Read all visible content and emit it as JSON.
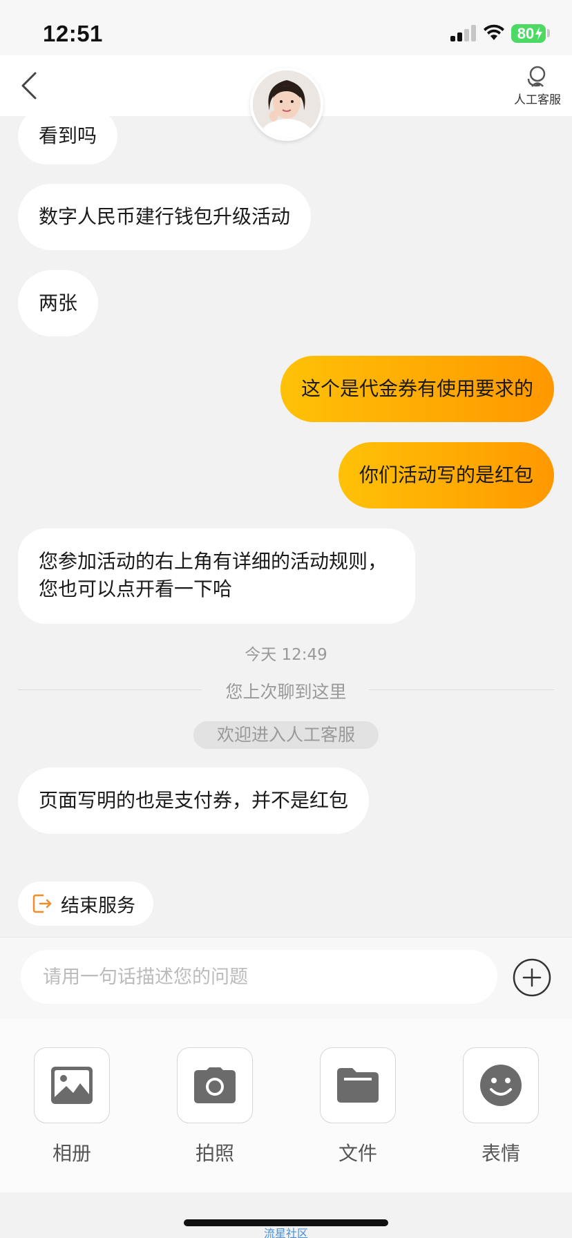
{
  "status_bar": {
    "time": "12:51",
    "battery": "80"
  },
  "header": {
    "back_icon": "chevron-left-icon",
    "agent_icon": "headset-icon",
    "agent_label": "人工客服"
  },
  "messages": [
    {
      "side": "in",
      "text": "看到吗"
    },
    {
      "side": "in",
      "text": "数字人民币建行钱包升级活动"
    },
    {
      "side": "in",
      "text": "两张"
    },
    {
      "side": "out",
      "text": "这个是代金券有使用要求的"
    },
    {
      "side": "out",
      "text": "你们活动写的是红包"
    },
    {
      "side": "in",
      "text": "您参加活动的右上角有详细的活动规则，您也可以点开看一下哈"
    },
    {
      "side": "in",
      "text": "页面写明的也是支付券，并不是红包"
    }
  ],
  "time_label": "今天 12:49",
  "divider_text": "您上次聊到这里",
  "system_pill": "欢迎进入人工客服",
  "end_service": {
    "label": "结束服务",
    "icon": "exit-icon"
  },
  "input": {
    "placeholder": "请用一句话描述您的问题",
    "plus_icon": "plus-circle-icon"
  },
  "toolbar": {
    "items": [
      {
        "label": "相册",
        "icon": "image-icon"
      },
      {
        "label": "拍照",
        "icon": "camera-icon"
      },
      {
        "label": "文件",
        "icon": "folder-icon"
      },
      {
        "label": "表情",
        "icon": "smiley-icon"
      }
    ]
  },
  "watermark": "流星社区",
  "colors": {
    "accent_start": "#ffc107",
    "accent_end": "#ff9800",
    "end_service_icon": "#f28c28",
    "battery": "#4cd964"
  }
}
